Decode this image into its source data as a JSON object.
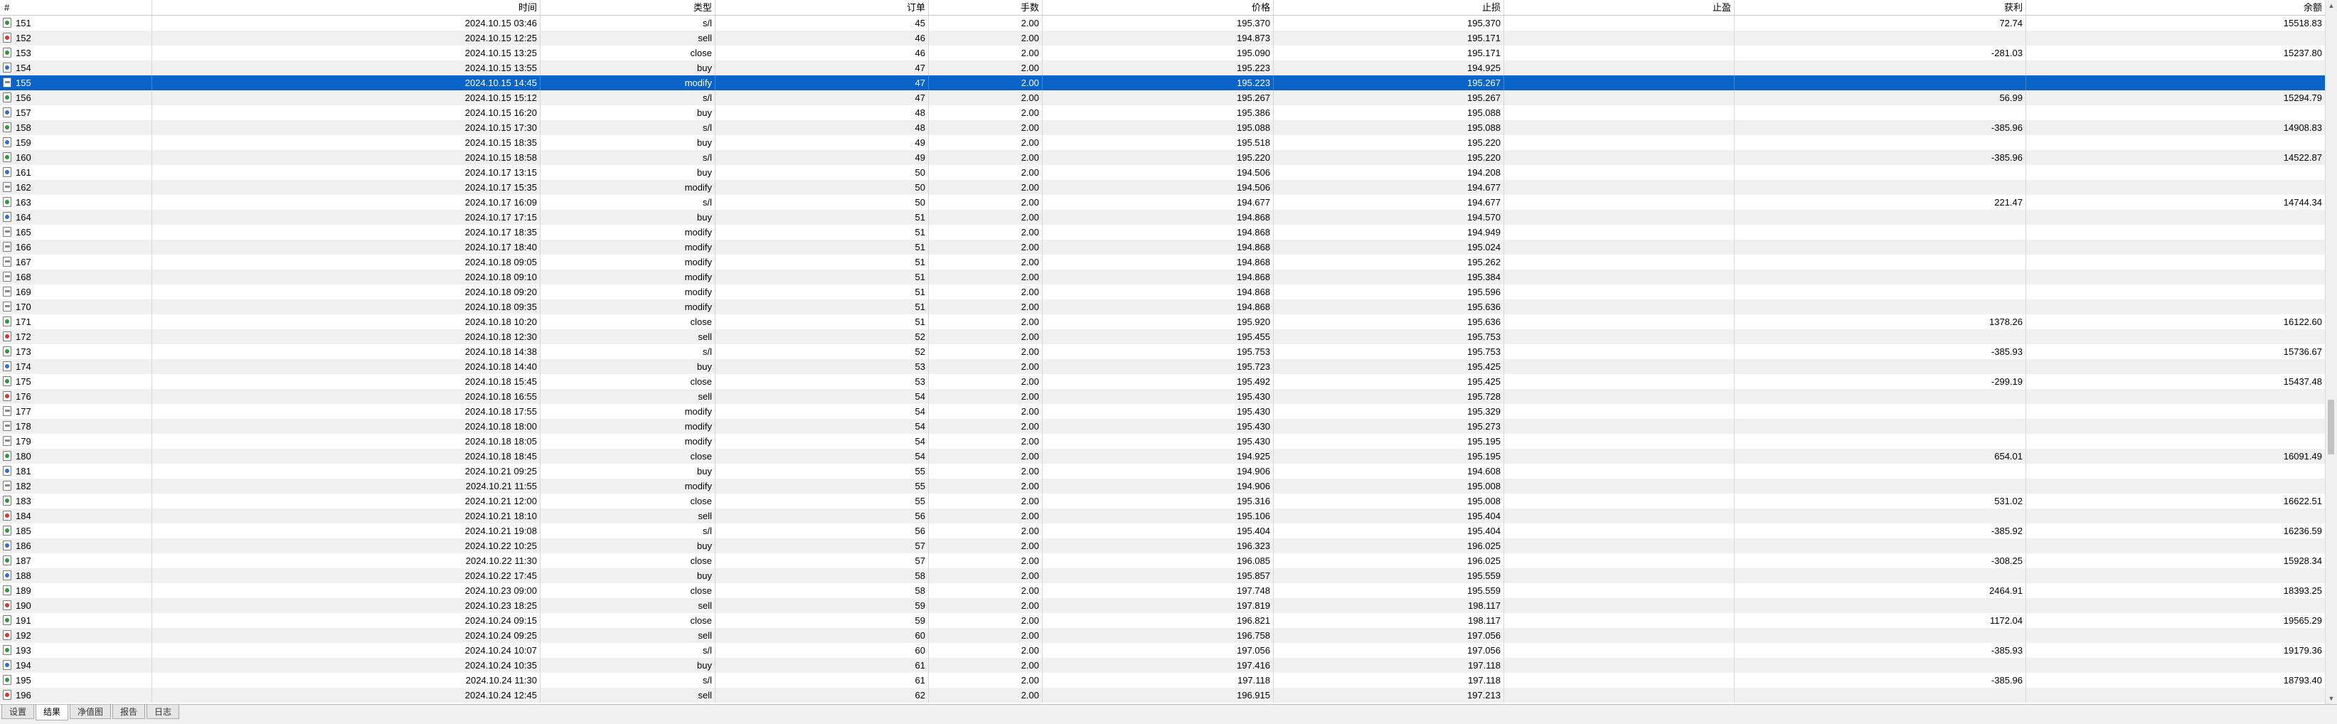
{
  "columns": [
    "#",
    "时间",
    "类型",
    "订单",
    "手数",
    "价格",
    "止损",
    "止盈",
    "获利",
    "余额"
  ],
  "rows": [
    {
      "id": "151",
      "time": "2024.10.15 03:46",
      "type": "s/l",
      "order": "45",
      "lots": "2.00",
      "price": "195.370",
      "sl": "195.370",
      "tp": "",
      "profit": "72.74",
      "balance": "15518.83"
    },
    {
      "id": "152",
      "time": "2024.10.15 12:25",
      "type": "sell",
      "order": "46",
      "lots": "2.00",
      "price": "194.873",
      "sl": "195.171",
      "tp": "",
      "profit": "",
      "balance": ""
    },
    {
      "id": "153",
      "time": "2024.10.15 13:25",
      "type": "close",
      "order": "46",
      "lots": "2.00",
      "price": "195.090",
      "sl": "195.171",
      "tp": "",
      "profit": "-281.03",
      "balance": "15237.80"
    },
    {
      "id": "154",
      "time": "2024.10.15 13:55",
      "type": "buy",
      "order": "47",
      "lots": "2.00",
      "price": "195.223",
      "sl": "194.925",
      "tp": "",
      "profit": "",
      "balance": ""
    },
    {
      "id": "155",
      "time": "2024.10.15 14:45",
      "type": "modify",
      "order": "47",
      "lots": "2.00",
      "price": "195.223",
      "sl": "195.267",
      "tp": "",
      "profit": "",
      "balance": ""
    },
    {
      "id": "156",
      "time": "2024.10.15 15:12",
      "type": "s/l",
      "order": "47",
      "lots": "2.00",
      "price": "195.267",
      "sl": "195.267",
      "tp": "",
      "profit": "56.99",
      "balance": "15294.79"
    },
    {
      "id": "157",
      "time": "2024.10.15 16:20",
      "type": "buy",
      "order": "48",
      "lots": "2.00",
      "price": "195.386",
      "sl": "195.088",
      "tp": "",
      "profit": "",
      "balance": ""
    },
    {
      "id": "158",
      "time": "2024.10.15 17:30",
      "type": "s/l",
      "order": "48",
      "lots": "2.00",
      "price": "195.088",
      "sl": "195.088",
      "tp": "",
      "profit": "-385.96",
      "balance": "14908.83"
    },
    {
      "id": "159",
      "time": "2024.10.15 18:35",
      "type": "buy",
      "order": "49",
      "lots": "2.00",
      "price": "195.518",
      "sl": "195.220",
      "tp": "",
      "profit": "",
      "balance": ""
    },
    {
      "id": "160",
      "time": "2024.10.15 18:58",
      "type": "s/l",
      "order": "49",
      "lots": "2.00",
      "price": "195.220",
      "sl": "195.220",
      "tp": "",
      "profit": "-385.96",
      "balance": "14522.87"
    },
    {
      "id": "161",
      "time": "2024.10.17 13:15",
      "type": "buy",
      "order": "50",
      "lots": "2.00",
      "price": "194.506",
      "sl": "194.208",
      "tp": "",
      "profit": "",
      "balance": ""
    },
    {
      "id": "162",
      "time": "2024.10.17 15:35",
      "type": "modify",
      "order": "50",
      "lots": "2.00",
      "price": "194.506",
      "sl": "194.677",
      "tp": "",
      "profit": "",
      "balance": ""
    },
    {
      "id": "163",
      "time": "2024.10.17 16:09",
      "type": "s/l",
      "order": "50",
      "lots": "2.00",
      "price": "194.677",
      "sl": "194.677",
      "tp": "",
      "profit": "221.47",
      "balance": "14744.34"
    },
    {
      "id": "164",
      "time": "2024.10.17 17:15",
      "type": "buy",
      "order": "51",
      "lots": "2.00",
      "price": "194.868",
      "sl": "194.570",
      "tp": "",
      "profit": "",
      "balance": ""
    },
    {
      "id": "165",
      "time": "2024.10.17 18:35",
      "type": "modify",
      "order": "51",
      "lots": "2.00",
      "price": "194.868",
      "sl": "194.949",
      "tp": "",
      "profit": "",
      "balance": ""
    },
    {
      "id": "166",
      "time": "2024.10.17 18:40",
      "type": "modify",
      "order": "51",
      "lots": "2.00",
      "price": "194.868",
      "sl": "195.024",
      "tp": "",
      "profit": "",
      "balance": ""
    },
    {
      "id": "167",
      "time": "2024.10.18 09:05",
      "type": "modify",
      "order": "51",
      "lots": "2.00",
      "price": "194.868",
      "sl": "195.262",
      "tp": "",
      "profit": "",
      "balance": ""
    },
    {
      "id": "168",
      "time": "2024.10.18 09:10",
      "type": "modify",
      "order": "51",
      "lots": "2.00",
      "price": "194.868",
      "sl": "195.384",
      "tp": "",
      "profit": "",
      "balance": ""
    },
    {
      "id": "169",
      "time": "2024.10.18 09:20",
      "type": "modify",
      "order": "51",
      "lots": "2.00",
      "price": "194.868",
      "sl": "195.596",
      "tp": "",
      "profit": "",
      "balance": ""
    },
    {
      "id": "170",
      "time": "2024.10.18 09:35",
      "type": "modify",
      "order": "51",
      "lots": "2.00",
      "price": "194.868",
      "sl": "195.636",
      "tp": "",
      "profit": "",
      "balance": ""
    },
    {
      "id": "171",
      "time": "2024.10.18 10:20",
      "type": "close",
      "order": "51",
      "lots": "2.00",
      "price": "195.920",
      "sl": "195.636",
      "tp": "",
      "profit": "1378.26",
      "balance": "16122.60"
    },
    {
      "id": "172",
      "time": "2024.10.18 12:30",
      "type": "sell",
      "order": "52",
      "lots": "2.00",
      "price": "195.455",
      "sl": "195.753",
      "tp": "",
      "profit": "",
      "balance": ""
    },
    {
      "id": "173",
      "time": "2024.10.18 14:38",
      "type": "s/l",
      "order": "52",
      "lots": "2.00",
      "price": "195.753",
      "sl": "195.753",
      "tp": "",
      "profit": "-385.93",
      "balance": "15736.67"
    },
    {
      "id": "174",
      "time": "2024.10.18 14:40",
      "type": "buy",
      "order": "53",
      "lots": "2.00",
      "price": "195.723",
      "sl": "195.425",
      "tp": "",
      "profit": "",
      "balance": ""
    },
    {
      "id": "175",
      "time": "2024.10.18 15:45",
      "type": "close",
      "order": "53",
      "lots": "2.00",
      "price": "195.492",
      "sl": "195.425",
      "tp": "",
      "profit": "-299.19",
      "balance": "15437.48"
    },
    {
      "id": "176",
      "time": "2024.10.18 16:55",
      "type": "sell",
      "order": "54",
      "lots": "2.00",
      "price": "195.430",
      "sl": "195.728",
      "tp": "",
      "profit": "",
      "balance": ""
    },
    {
      "id": "177",
      "time": "2024.10.18 17:55",
      "type": "modify",
      "order": "54",
      "lots": "2.00",
      "price": "195.430",
      "sl": "195.329",
      "tp": "",
      "profit": "",
      "balance": ""
    },
    {
      "id": "178",
      "time": "2024.10.18 18:00",
      "type": "modify",
      "order": "54",
      "lots": "2.00",
      "price": "195.430",
      "sl": "195.273",
      "tp": "",
      "profit": "",
      "balance": ""
    },
    {
      "id": "179",
      "time": "2024.10.18 18:05",
      "type": "modify",
      "order": "54",
      "lots": "2.00",
      "price": "195.430",
      "sl": "195.195",
      "tp": "",
      "profit": "",
      "balance": ""
    },
    {
      "id": "180",
      "time": "2024.10.18 18:45",
      "type": "close",
      "order": "54",
      "lots": "2.00",
      "price": "194.925",
      "sl": "195.195",
      "tp": "",
      "profit": "654.01",
      "balance": "16091.49"
    },
    {
      "id": "181",
      "time": "2024.10.21 09:25",
      "type": "buy",
      "order": "55",
      "lots": "2.00",
      "price": "194.906",
      "sl": "194.608",
      "tp": "",
      "profit": "",
      "balance": ""
    },
    {
      "id": "182",
      "time": "2024.10.21 11:55",
      "type": "modify",
      "order": "55",
      "lots": "2.00",
      "price": "194.906",
      "sl": "195.008",
      "tp": "",
      "profit": "",
      "balance": ""
    },
    {
      "id": "183",
      "time": "2024.10.21 12:00",
      "type": "close",
      "order": "55",
      "lots": "2.00",
      "price": "195.316",
      "sl": "195.008",
      "tp": "",
      "profit": "531.02",
      "balance": "16622.51"
    },
    {
      "id": "184",
      "time": "2024.10.21 18:10",
      "type": "sell",
      "order": "56",
      "lots": "2.00",
      "price": "195.106",
      "sl": "195.404",
      "tp": "",
      "profit": "",
      "balance": ""
    },
    {
      "id": "185",
      "time": "2024.10.21 19:08",
      "type": "s/l",
      "order": "56",
      "lots": "2.00",
      "price": "195.404",
      "sl": "195.404",
      "tp": "",
      "profit": "-385.92",
      "balance": "16236.59"
    },
    {
      "id": "186",
      "time": "2024.10.22 10:25",
      "type": "buy",
      "order": "57",
      "lots": "2.00",
      "price": "196.323",
      "sl": "196.025",
      "tp": "",
      "profit": "",
      "balance": ""
    },
    {
      "id": "187",
      "time": "2024.10.22 11:30",
      "type": "close",
      "order": "57",
      "lots": "2.00",
      "price": "196.085",
      "sl": "196.025",
      "tp": "",
      "profit": "-308.25",
      "balance": "15928.34"
    },
    {
      "id": "188",
      "time": "2024.10.22 17:45",
      "type": "buy",
      "order": "58",
      "lots": "2.00",
      "price": "195.857",
      "sl": "195.559",
      "tp": "",
      "profit": "",
      "balance": ""
    },
    {
      "id": "189",
      "time": "2024.10.23 09:00",
      "type": "close",
      "order": "58",
      "lots": "2.00",
      "price": "197.748",
      "sl": "195.559",
      "tp": "",
      "profit": "2464.91",
      "balance": "18393.25"
    },
    {
      "id": "190",
      "time": "2024.10.23 18:25",
      "type": "sell",
      "order": "59",
      "lots": "2.00",
      "price": "197.819",
      "sl": "198.117",
      "tp": "",
      "profit": "",
      "balance": ""
    },
    {
      "id": "191",
      "time": "2024.10.24 09:15",
      "type": "close",
      "order": "59",
      "lots": "2.00",
      "price": "196.821",
      "sl": "198.117",
      "tp": "",
      "profit": "1172.04",
      "balance": "19565.29"
    },
    {
      "id": "192",
      "time": "2024.10.24 09:25",
      "type": "sell",
      "order": "60",
      "lots": "2.00",
      "price": "196.758",
      "sl": "197.056",
      "tp": "",
      "profit": "",
      "balance": ""
    },
    {
      "id": "193",
      "time": "2024.10.24 10:07",
      "type": "s/l",
      "order": "60",
      "lots": "2.00",
      "price": "197.056",
      "sl": "197.056",
      "tp": "",
      "profit": "-385.93",
      "balance": "19179.36"
    },
    {
      "id": "194",
      "time": "2024.10.24 10:35",
      "type": "buy",
      "order": "61",
      "lots": "2.00",
      "price": "197.416",
      "sl": "197.118",
      "tp": "",
      "profit": "",
      "balance": ""
    },
    {
      "id": "195",
      "time": "2024.10.24 11:30",
      "type": "s/l",
      "order": "61",
      "lots": "2.00",
      "price": "197.118",
      "sl": "197.118",
      "tp": "",
      "profit": "-385.96",
      "balance": "18793.40"
    },
    {
      "id": "196",
      "time": "2024.10.24 12:45",
      "type": "sell",
      "order": "62",
      "lots": "2.00",
      "price": "196.915",
      "sl": "197.213",
      "tp": "",
      "profit": "",
      "balance": ""
    }
  ],
  "selected_row": "155",
  "tabs": [
    {
      "label": "设置",
      "active": false
    },
    {
      "label": "结果",
      "active": true
    },
    {
      "label": "净值图",
      "active": false
    },
    {
      "label": "报告",
      "active": false
    },
    {
      "label": "日志",
      "active": false
    }
  ],
  "scrollbar": {
    "position_fraction": 0.62,
    "visible_fraction": 0.08
  },
  "colors": {
    "selection": "#0a64c8",
    "row_alt": "#f0f0f0",
    "buy": "#2f6fd0",
    "sell": "#d23b2b",
    "close": "#2a9a3a"
  }
}
